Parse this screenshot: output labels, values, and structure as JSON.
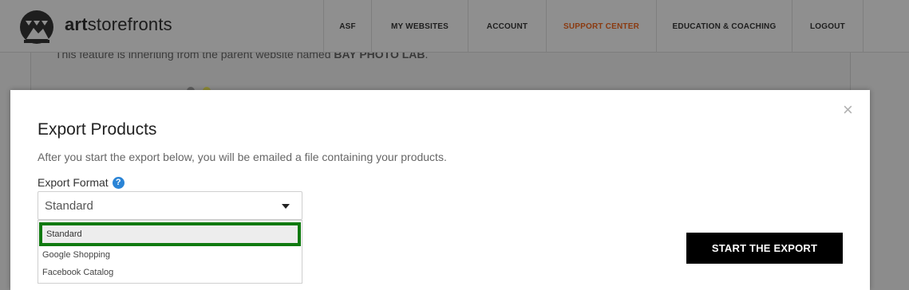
{
  "brand": {
    "name_part1": "art",
    "name_part2": "storefronts"
  },
  "nav": {
    "items": [
      {
        "label": "ASF"
      },
      {
        "label": "MY WEBSITES"
      },
      {
        "label": "ACCOUNT"
      },
      {
        "label": "SUPPORT CENTER"
      },
      {
        "label": "EDUCATION & COACHING"
      },
      {
        "label": "LOGOUT"
      }
    ]
  },
  "background": {
    "notice_prefix": "This feature is inheriting from the parent website named ",
    "notice_name": "BAY PHOTO LAB",
    "notice_suffix": "."
  },
  "modal": {
    "close": "×",
    "title": "Export Products",
    "description": "After you start the export below, you will be emailed a file containing your products.",
    "format_label": "Export Format",
    "help": "?",
    "selected_value": "Standard",
    "options": [
      "Standard",
      "Google Shopping",
      "Facebook Catalog"
    ],
    "start_button": "START THE EXPORT"
  },
  "colors": {
    "active_nav": "#8a3a10",
    "highlight_border": "#107a10",
    "button_bg": "#000000",
    "help_icon": "#2a84d6"
  }
}
